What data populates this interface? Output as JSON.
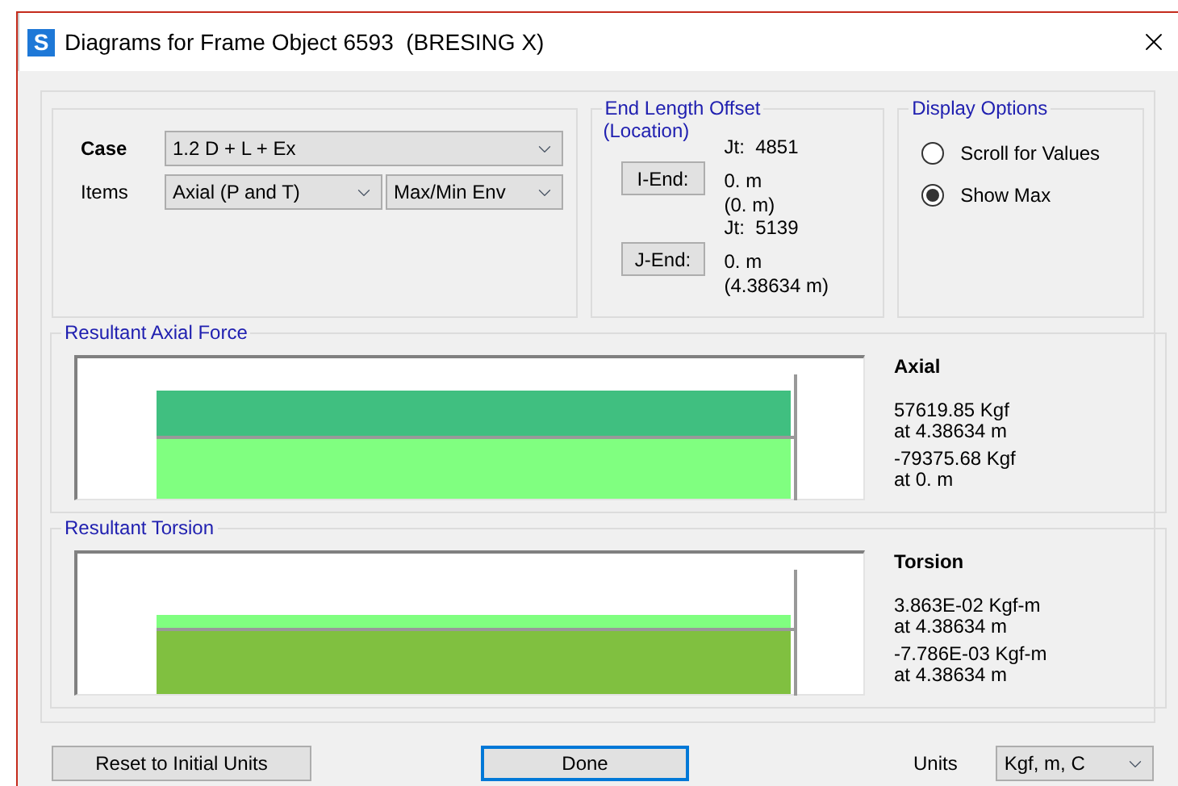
{
  "window": {
    "title": "Diagrams for Frame Object 6593  (BRESING X)",
    "app_letter": "S"
  },
  "case": {
    "label": "Case",
    "value": "1.2 D + L + Ex"
  },
  "items": {
    "label": "Items",
    "values": [
      "Axial (P and T)",
      "Max/Min Env"
    ]
  },
  "end_length_offset": {
    "title": "End Length Offset",
    "subtitle": "(Location)",
    "ends": [
      {
        "joint": "Jt:  4851",
        "button": "I-End:",
        "offset": "0. m",
        "location": "(0. m)"
      },
      {
        "joint": "Jt:  5139",
        "button": "J-End:",
        "offset": "0. m",
        "location": "(4.38634 m)"
      }
    ]
  },
  "display_options": {
    "title": "Display Options",
    "options": [
      {
        "label": "Scroll for Values",
        "selected": false
      },
      {
        "label": "Show Max",
        "selected": true
      }
    ]
  },
  "diagrams": [
    {
      "kind": "axial",
      "title": "Resultant Axial Force",
      "heading": "Axial",
      "max_value": "57619.85 Kgf",
      "max_at": "at 4.38634 m",
      "min_value": "-79375.68 Kgf",
      "min_at": "at 0. m"
    },
    {
      "kind": "torsion",
      "title": "Resultant Torsion",
      "heading": "Torsion",
      "max_value": "3.863E-02 Kgf-m",
      "max_at": "at 4.38634 m",
      "min_value": "-7.786E-03 Kgf-m",
      "min_at": "at 4.38634 m"
    }
  ],
  "footer": {
    "reset_button": "Reset to Initial Units",
    "done_button": "Done",
    "units_label": "Units",
    "units_value": "Kgf, m, C"
  }
}
